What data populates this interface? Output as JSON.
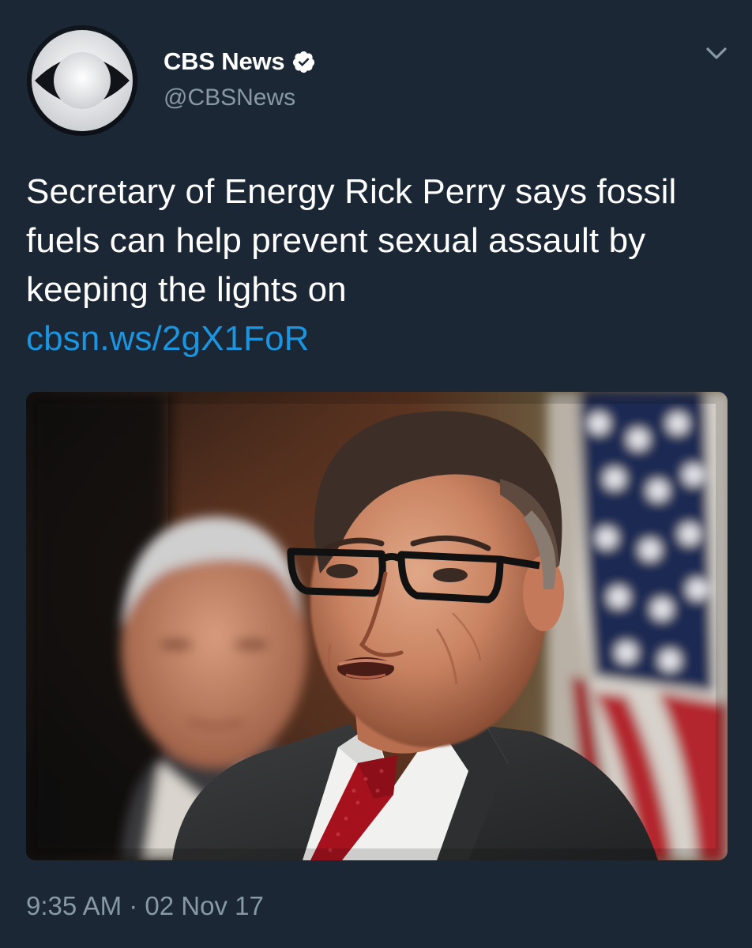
{
  "author": {
    "display_name": "CBS News",
    "handle": "@CBSNews",
    "verified": true,
    "avatar_icon": "cbs-eye-logo-icon"
  },
  "menu": {
    "icon": "chevron-down-icon"
  },
  "tweet": {
    "text": "Secretary of Energy Rick Perry says fossil fuels can help prevent sexual assault by keeping the lights on",
    "link": "cbsn.ws/2gX1FoR"
  },
  "media": {
    "type": "photo"
  },
  "footer": {
    "time": "9:35 AM",
    "separator": "·",
    "date": "02 Nov 17"
  },
  "colors": {
    "background": "#1b2735",
    "text": "#ffffff",
    "secondary": "#8899a6",
    "link": "#1b95e0",
    "verified_badge": "#ffffff"
  }
}
